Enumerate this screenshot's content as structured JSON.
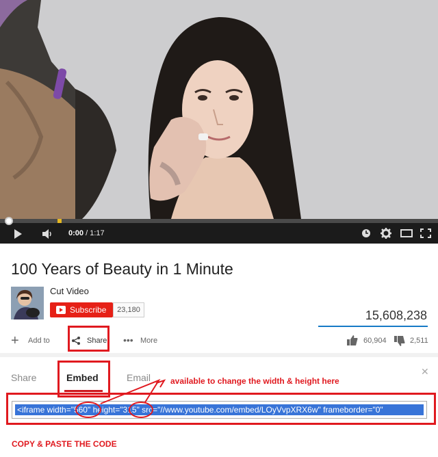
{
  "player": {
    "time_current": "0:00",
    "time_separator": " / ",
    "time_total": "1:17",
    "progress_fraction": 0.0
  },
  "video": {
    "title": "100 Years of Beauty in 1 Minute",
    "channel": "Cut Video",
    "subscribe_label": "Subscribe",
    "subscriber_count": "23,180",
    "views": "15,608,238"
  },
  "actions": {
    "add_to": "Add to",
    "share": "Share",
    "more": "More",
    "likes": "60,904",
    "dislikes": "2,511"
  },
  "share_panel": {
    "tabs": [
      "Share",
      "Embed",
      "Email"
    ],
    "active_tab": "Embed",
    "embed_code": "<iframe width=\"560\" height=\"315\" src=\"//www.youtube.com/embed/LOyVvpXRX6w\" frameborder=\"0\""
  },
  "annotations": {
    "size_note": "available to change the width & height here",
    "copy_note": "COPY & PASTE THE CODE"
  },
  "colors": {
    "brand_red": "#e62117",
    "annotation_red": "#e0191f",
    "selection_blue": "#3874d8"
  }
}
